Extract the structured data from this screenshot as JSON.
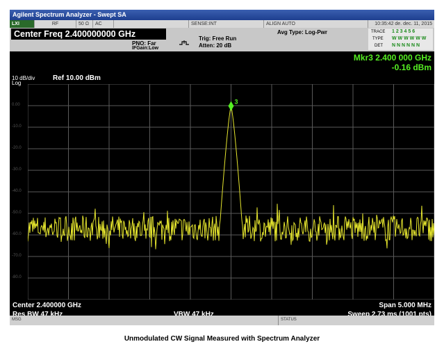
{
  "window": {
    "title": "Agilent Spectrum Analyzer - Swept SA"
  },
  "status_row": {
    "lxi": "LXI",
    "rf": "RF",
    "impedance": "50 Ω",
    "coupling": "AC",
    "sense": "SENSE:INT",
    "align": "ALIGN AUTO",
    "datetime": "10:35:42 de. dec. 11, 2015"
  },
  "settings": {
    "center_freq_label": "Center Freq 2.400000000 GHz",
    "pno": "PNO: Far",
    "ifgain": "IFGain:Low",
    "trig": "Trig: Free Run",
    "atten": "Atten: 20 dB",
    "avg_type": "Avg Type: Log-Pwr"
  },
  "trace_info": {
    "trace_label": "TRACE",
    "trace_values": "1 2 3 4 5 6",
    "type_label": "TYPE",
    "type_values": "W W W W W W",
    "det_label": "DET",
    "det_values": "N N N N N N"
  },
  "marker": {
    "line1": "Mkr3 2.400 000 GHz",
    "line2": "-0.16 dBm",
    "number": "3",
    "freq_ghz": 2.4,
    "amp_dbm": -0.16
  },
  "scale": {
    "div": "10 dB/div",
    "log": "Log",
    "ref": "Ref 10.00 dBm"
  },
  "footer": {
    "center": "Center 2.400000 GHz",
    "res_bw": "Res BW 47 kHz",
    "vbw": "VBW 47 kHz",
    "span": "Span 5.000 MHz",
    "sweep": "Sweep 2.73 ms (1001 pts)"
  },
  "bottom_bar": {
    "msg": "MSG",
    "status": "STATUS"
  },
  "caption": "Unmodulated CW Signal Measured with Spectrum Analyzer",
  "colors": {
    "trace": "#e6e62e",
    "grid": "#5a5a5a",
    "marker": "#55ee22"
  },
  "chart_data": {
    "type": "line",
    "y_ticks": [
      "0.00",
      "-10.0",
      "-20.0",
      "-30.0",
      "-40.0",
      "-50.0",
      "-60.0",
      "-70.0",
      "-80.0"
    ],
    "ylim": [
      -90,
      10
    ],
    "xlim_ghz": [
      2.3975,
      2.4025
    ],
    "noise_floor_dbm": -57,
    "peak": {
      "x_ghz": 2.4,
      "y_dbm": -0.16
    },
    "grid": true
  }
}
